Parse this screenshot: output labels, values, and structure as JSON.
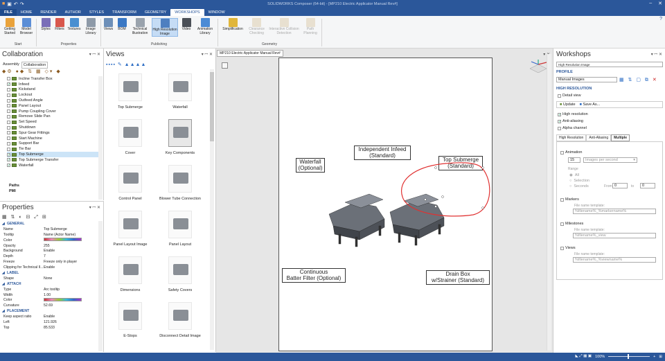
{
  "window": {
    "title": "SOLIDWORKS Composer (64-bit) - [MP210 Electric Applicator Manual Rev#]",
    "controls": [
      "–",
      "✕"
    ]
  },
  "menu": {
    "tabs": [
      "FILE",
      "HOME",
      "RENDER",
      "AUTHOR",
      "STYLES",
      "TRANSFORM",
      "GEOMETRY",
      "WORKSHOPS",
      "WINDOW"
    ],
    "active": "WORKSHOPS"
  },
  "ribbon": {
    "start": {
      "group": "Start",
      "buttons": [
        "Getting Started",
        "Model Browser"
      ]
    },
    "properties": {
      "group": "Properties",
      "buttons": [
        "Styles",
        "Filters",
        "Textures",
        "Image Library"
      ]
    },
    "publishing": {
      "group": "Publishing",
      "buttons": [
        "Views",
        "BOM",
        "Technical Illustration",
        "High Resolution Image",
        "Video",
        "Animation Library"
      ]
    },
    "geometry": {
      "group": "Geometry",
      "buttons": [
        "Simplification",
        "Clearance Checking",
        "Interactive Collision Detection",
        "Path Planning"
      ]
    }
  },
  "collaboration": {
    "title": "Collaboration",
    "tabs": [
      "Assembly",
      "Collaboration"
    ],
    "items": [
      {
        "label": "Incline Transfer Box",
        "checked": false
      },
      {
        "label": "Infeed",
        "checked": true
      },
      {
        "label": "Kickstand",
        "checked": false
      },
      {
        "label": "Lockout",
        "checked": false
      },
      {
        "label": "Outfeed Angle",
        "checked": false
      },
      {
        "label": "Panel Layout",
        "checked": false
      },
      {
        "label": "Pump Coupling Cover",
        "checked": false
      },
      {
        "label": "Remove Slide Pan",
        "checked": false
      },
      {
        "label": "Set Speed",
        "checked": false
      },
      {
        "label": "Shutdown",
        "checked": false
      },
      {
        "label": "Spur Gear Fittings",
        "checked": false
      },
      {
        "label": "Start Machine",
        "checked": false
      },
      {
        "label": "Support Bar",
        "checked": false
      },
      {
        "label": "Tie Bar",
        "checked": false
      },
      {
        "label": "Top Submerge",
        "checked": true,
        "selected": true
      },
      {
        "label": "Top Submerge Transfer",
        "checked": true
      },
      {
        "label": "Waterfall",
        "checked": true
      }
    ],
    "footer": [
      "Paths",
      "PMI"
    ]
  },
  "properties": {
    "title": "Properties",
    "rows": [
      {
        "section": "GENERAL"
      },
      {
        "k": "Name",
        "v": "Top Submerge"
      },
      {
        "k": "Tooltip",
        "v": "Name (Actor Name)"
      },
      {
        "k": "Color",
        "v": ""
      },
      {
        "k": "Opacity",
        "v": "255"
      },
      {
        "k": "Background",
        "v": "Enable"
      },
      {
        "k": "Depth",
        "v": "7"
      },
      {
        "k": "Freeze",
        "v": "Freeze only in player"
      },
      {
        "k": "Clipping for Technical Il...",
        "v": "Enable"
      },
      {
        "section": "LABEL"
      },
      {
        "k": "Shape",
        "v": "None"
      },
      {
        "section": "ATTACH"
      },
      {
        "k": "Type",
        "v": "Arc tooltip"
      },
      {
        "k": "Width",
        "v": "1.00"
      },
      {
        "k": "Color",
        "v": ""
      },
      {
        "k": "Curvature",
        "v": "52.69"
      },
      {
        "section": "PLACEMENT"
      },
      {
        "k": "Keep aspect ratio",
        "v": "Enable"
      },
      {
        "k": "Left",
        "v": "121.926"
      },
      {
        "k": "Top",
        "v": "85.533"
      }
    ]
  },
  "views": {
    "title": "Views",
    "items": [
      "Top Submerge",
      "Waterfall",
      "Cover",
      "Key Components",
      "Control Panel",
      "Blower Tube Connection",
      "Panel Layout Image",
      "Panel Layout",
      "Dimensions",
      "Safety Covers",
      "E-Stops",
      "Disconnect Detail Image"
    ],
    "selected": "Key Components"
  },
  "document": {
    "tab": "MP210 Electric Applicator Manual Rev#",
    "labels": [
      {
        "id": "waterfall",
        "l1": "Waterfall",
        "l2": "(Optional)"
      },
      {
        "id": "infeed",
        "l1": "Independent Infeed",
        "l2": "(Standard)"
      },
      {
        "id": "submerge",
        "l1": "Top Submerge",
        "l2": "(Standard)"
      },
      {
        "id": "batter",
        "l1": "Continuous",
        "l2": "Batter Filter (Optional)"
      },
      {
        "id": "drain",
        "l1": "Drain Box",
        "l2": "w/Strainer (Standard)"
      }
    ]
  },
  "workshops": {
    "title": "Workshops",
    "selector": "High Resolution Image",
    "profile_label": "PROFILE",
    "profile_value": "Manual Images",
    "hires_label": "HIGH RESOLUTION",
    "detail_view": "Detail view",
    "update": "Update",
    "save_as": "Save As...",
    "options": [
      {
        "label": "High resolution",
        "checked": true
      },
      {
        "label": "Anti-aliasing",
        "checked": true
      },
      {
        "label": "Alpha channel",
        "checked": false
      }
    ],
    "tabs": [
      "High Resolution",
      "Anti-Aliasing",
      "Multiple"
    ],
    "active_tab": "Multiple",
    "animation": {
      "label": "Animation",
      "value": "15",
      "unit": "Images per second"
    },
    "range": {
      "label": "Range",
      "options": [
        "All",
        "Selection",
        "Seconds"
      ],
      "from_label": "From",
      "from": "0",
      "to_label": "to",
      "to": "0"
    },
    "markers": {
      "label": "Markers",
      "template_label": "File name template:",
      "template": "%filename%_%markername%"
    },
    "milestones": {
      "label": "Milestones",
      "template_label": "File name template:",
      "template": "%filename%_view"
    },
    "views": {
      "label": "Views",
      "template_label": "File name template:",
      "template": "%filename%_%viewname%"
    }
  },
  "status": {
    "zoom": "100%"
  }
}
